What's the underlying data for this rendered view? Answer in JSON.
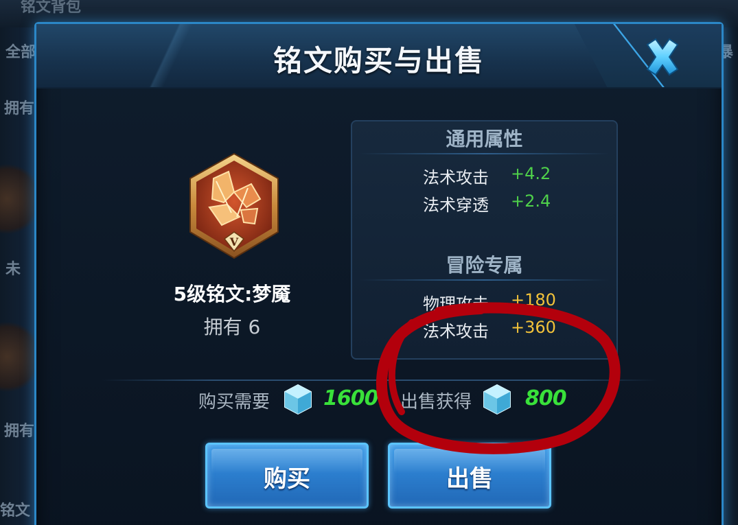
{
  "background": {
    "top_title": "铭文背包",
    "left_labels": [
      "全部",
      "拥有",
      "未",
      "拥有",
      "铭文"
    ],
    "right_labels": [
      "暴"
    ]
  },
  "dialog": {
    "title": "铭文购买与出售"
  },
  "rune": {
    "name": "5级铭文:梦魇",
    "owned": "拥有 6",
    "level_numeral": "V"
  },
  "stats": {
    "general_header": "通用属性",
    "general": [
      {
        "label": "法术攻击",
        "value": "+4.2"
      },
      {
        "label": "法术穿透",
        "value": "+2.4"
      }
    ],
    "adventure_header": "冒险专属",
    "adventure": [
      {
        "label": "物理攻击",
        "value": "+180"
      },
      {
        "label": "法术攻击",
        "value": "+360"
      }
    ]
  },
  "prices": {
    "buy_label": "购买需要",
    "buy_value": "1600",
    "sell_label": "出售获得",
    "sell_value": "800"
  },
  "buttons": {
    "buy": "购买",
    "sell": "出售"
  },
  "colors": {
    "accent_blue": "#2b87c7",
    "price_green": "#39e13a",
    "stat_green": "#4fd14a",
    "stat_yellow": "#f2c23a",
    "annotation_red": "#b3000c"
  },
  "icons": {
    "close": "close-x-icon",
    "currency": "crystal-gem-icon",
    "rune": "rune-emblem-icon"
  }
}
